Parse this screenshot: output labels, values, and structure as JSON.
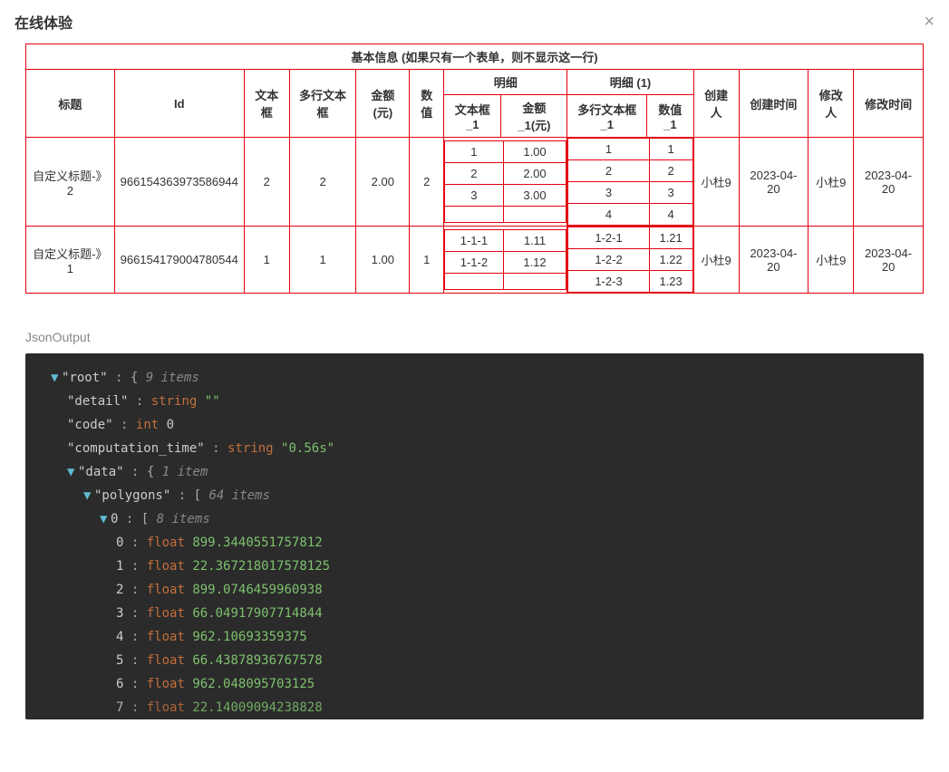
{
  "modal": {
    "title": "在线体验",
    "close_icon": "×"
  },
  "table": {
    "group_header": "基本信息  (如果只有一个表单，则不显示这一行)",
    "cols": {
      "title": "标题",
      "id": "Id",
      "textbox": "文本框",
      "multiline": "多行文本框",
      "amount": "金额(元)",
      "number": "数值",
      "detail_group": "明细",
      "detail_group_1": "明细  (1)",
      "detail_text": "文本框_1",
      "detail_amount": "金额_1(元)",
      "detail_multiline": "多行文本框_1",
      "detail_number": "数值_1",
      "creator": "创建人",
      "create_time": "创建时间",
      "modifier": "修改人",
      "modify_time": "修改时间"
    },
    "rows": [
      {
        "title": "自定义标题-》2",
        "id": "966154363973586944",
        "textbox": "2",
        "multiline": "2",
        "amount": "2.00",
        "number": "2",
        "detail_a": [
          {
            "text": "1",
            "amount": "1.00"
          },
          {
            "text": "2",
            "amount": "2.00"
          },
          {
            "text": "3",
            "amount": "3.00"
          },
          {
            "text": "",
            "amount": ""
          }
        ],
        "detail_b": [
          {
            "multiline": "1",
            "number": "1"
          },
          {
            "multiline": "2",
            "number": "2"
          },
          {
            "multiline": "3",
            "number": "3"
          },
          {
            "multiline": "4",
            "number": "4"
          }
        ],
        "creator": "小杜9",
        "create_time": "2023-04-20",
        "modifier": "小杜9",
        "modify_time": "2023-04-20"
      },
      {
        "title": "自定义标题-》1",
        "id": "966154179004780544",
        "textbox": "1",
        "multiline": "1",
        "amount": "1.00",
        "number": "1",
        "detail_a": [
          {
            "text": "1-1-1",
            "amount": "1.11"
          },
          {
            "text": "1-1-2",
            "amount": "1.12"
          },
          {
            "text": "",
            "amount": ""
          }
        ],
        "detail_b": [
          {
            "multiline": "1-2-1",
            "number": "1.21"
          },
          {
            "multiline": "1-2-2",
            "number": "1.22"
          },
          {
            "multiline": "1-2-3",
            "number": "1.23"
          }
        ],
        "creator": "小杜9",
        "create_time": "2023-04-20",
        "modifier": "小杜9",
        "modify_time": "2023-04-20"
      }
    ]
  },
  "json_section": {
    "label": "JsonOutput",
    "root_key": "root",
    "root_meta": "9 items",
    "entries": {
      "detail": {
        "type": "string",
        "value": "\"\""
      },
      "code": {
        "type": "int",
        "value": "0"
      },
      "computation_time": {
        "type": "string",
        "value": "\"0.56s\""
      },
      "data_meta": "1 item",
      "polygons_meta": "64 items",
      "poly0_meta": "8 items",
      "floats": [
        "899.3440551757812",
        "22.367218017578125",
        "899.0746459960938",
        "66.04917907714844",
        "962.10693359375",
        "66.43878936767578",
        "962.048095703125",
        "22.14009094238828"
      ]
    }
  }
}
